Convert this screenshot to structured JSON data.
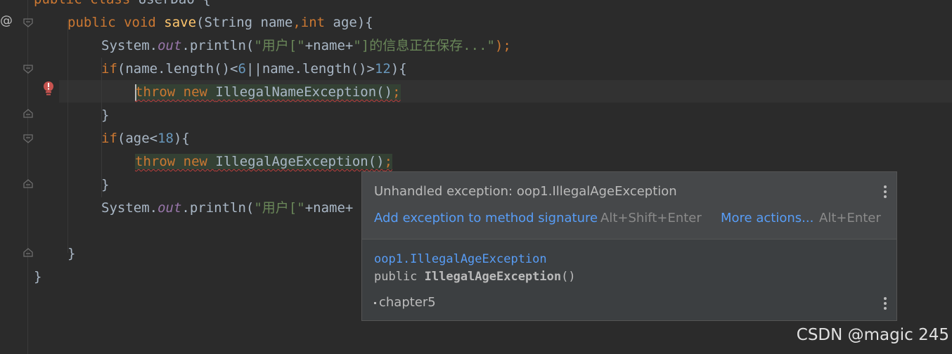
{
  "editor": {
    "lines": [
      {
        "id": "class-decl",
        "tokens": [
          {
            "t": "public class ",
            "c": "kw"
          },
          {
            "t": "UserDao {",
            "c": "op"
          }
        ]
      },
      {
        "id": "method-decl",
        "tokens": [
          {
            "t": "public void ",
            "c": "kw"
          },
          {
            "t": "save",
            "c": "fn"
          },
          {
            "t": "(String name",
            "c": "op"
          },
          {
            "t": ",",
            "c": "kw"
          },
          {
            "t": "int ",
            "c": "kw"
          },
          {
            "t": "age){",
            "c": "op"
          }
        ]
      },
      {
        "id": "print-1",
        "tokens": [
          {
            "t": "System.",
            "c": "op"
          },
          {
            "t": "out",
            "c": "fld"
          },
          {
            "t": ".println(",
            "c": "op"
          },
          {
            "t": "\"用户[\"",
            "c": "str"
          },
          {
            "t": "+name+",
            "c": "op"
          },
          {
            "t": "\"]的信息正在保存...\"",
            "c": "str"
          },
          {
            "t": ");",
            "c": "kw"
          }
        ]
      },
      {
        "id": "if-1",
        "tokens": [
          {
            "t": "if",
            "c": "kw"
          },
          {
            "t": "(name.length()<",
            "c": "op"
          },
          {
            "t": "6",
            "c": "num"
          },
          {
            "t": "||name.length()>",
            "c": "op"
          },
          {
            "t": "12",
            "c": "num"
          },
          {
            "t": "){",
            "c": "op"
          }
        ]
      },
      {
        "id": "throw-1",
        "tokens": [
          {
            "t": "throw new ",
            "c": "kw"
          },
          {
            "t": "IllegalNameException()",
            "c": "op"
          },
          {
            "t": ";",
            "c": "kw"
          }
        ]
      },
      {
        "id": "close-1",
        "tokens": [
          {
            "t": "}",
            "c": "op"
          }
        ]
      },
      {
        "id": "if-2",
        "tokens": [
          {
            "t": "if",
            "c": "kw"
          },
          {
            "t": "(age<",
            "c": "op"
          },
          {
            "t": "18",
            "c": "num"
          },
          {
            "t": "){",
            "c": "op"
          }
        ]
      },
      {
        "id": "throw-2",
        "tokens": [
          {
            "t": "throw new ",
            "c": "kw"
          },
          {
            "t": "IllegalAgeException()",
            "c": "op"
          },
          {
            "t": ";",
            "c": "kw"
          }
        ]
      },
      {
        "id": "close-2",
        "tokens": [
          {
            "t": "}",
            "c": "op"
          }
        ]
      },
      {
        "id": "print-2",
        "tokens": [
          {
            "t": "System.",
            "c": "op"
          },
          {
            "t": "out",
            "c": "fld"
          },
          {
            "t": ".println(",
            "c": "op"
          },
          {
            "t": "\"用户[\"",
            "c": "str"
          },
          {
            "t": "+name+",
            "c": "op"
          }
        ]
      },
      {
        "id": "blank",
        "tokens": []
      },
      {
        "id": "close-method",
        "tokens": [
          {
            "t": "}",
            "c": "op"
          }
        ]
      },
      {
        "id": "close-class",
        "tokens": [
          {
            "t": "}",
            "c": "op"
          }
        ]
      }
    ]
  },
  "gutter": {
    "override_marker": "@"
  },
  "popup": {
    "title": "Unhandled exception: oop1.IllegalAgeException",
    "action_primary": "Add exception to method signature",
    "action_primary_shortcut": "Alt+Shift+Enter",
    "action_more": "More actions...",
    "action_more_shortcut": "Alt+Enter",
    "qualified_name": "oop1.IllegalAgeException",
    "signature_prefix": "public ",
    "signature_name": "IllegalAgeException",
    "signature_suffix": "()",
    "module": "chapter5"
  },
  "watermark": "CSDN @magic 245",
  "colors": {
    "keyword": "#cc7832",
    "method": "#ffc66d",
    "string": "#6a8759",
    "number": "#6897bb",
    "field": "#9876aa",
    "text": "#a9b7c6",
    "link": "#589df6",
    "error": "#bc3f3c"
  }
}
